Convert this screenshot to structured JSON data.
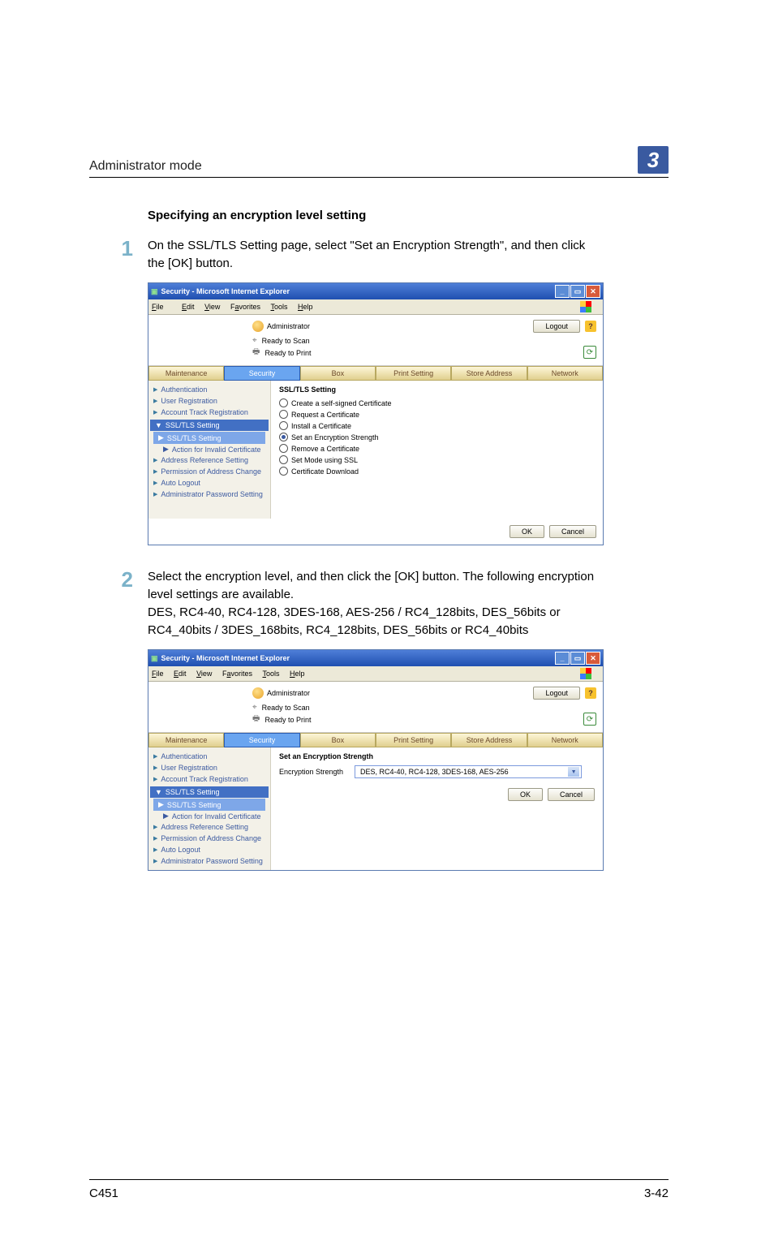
{
  "header": {
    "section_title": "Administrator mode",
    "section_number": "3"
  },
  "subhead": "Specifying an encryption level setting",
  "steps": {
    "s1": {
      "num": "1",
      "text": "On the SSL/TLS Setting page, select \"Set an Encryption Strength\", and then click the [OK] button."
    },
    "s2": {
      "num": "2",
      "text": "Select the encryption level, and then click the [OK] button. The following encryption level settings are available.\nDES, RC4-40, RC4-128, 3DES-168, AES-256 / RC4_128bits, DES_56bits or RC4_40bits / 3DES_168bits, RC4_128bits, DES_56bits or RC4_40bits"
    }
  },
  "browser_common": {
    "title": "Security - Microsoft Internet Explorer",
    "menus": {
      "file": "File",
      "edit": "Edit",
      "view": "View",
      "favorites": "Favorites",
      "tools": "Tools",
      "help": "Help"
    },
    "admin_label": "Administrator",
    "logout": "Logout",
    "status_scan": "Ready to Scan",
    "status_print": "Ready to Print",
    "tabs": {
      "maintenance": "Maintenance",
      "security": "Security",
      "box": "Box",
      "print": "Print Setting",
      "store": "Store Address",
      "network": "Network"
    },
    "ok": "OK",
    "cancel": "Cancel"
  },
  "sidebar": {
    "auth": "Authentication",
    "user_reg": "User Registration",
    "acct": "Account Track Registration",
    "ssl_cat": "SSL/TLS Setting",
    "ssl_sub": "SSL/TLS Setting",
    "action_invalid": "Action for Invalid Certificate",
    "addr_ref": "Address Reference Setting",
    "perm_change": "Permission of Address Change",
    "auto_logout": "Auto Logout",
    "admin_pwd": "Administrator Password Setting"
  },
  "panel1": {
    "title": "SSL/TLS Setting",
    "options": {
      "create": "Create a self-signed Certificate",
      "request": "Request a Certificate",
      "install": "Install a Certificate",
      "set_enc": "Set an Encryption Strength",
      "remove": "Remove a Certificate",
      "set_mode": "Set Mode using SSL",
      "download": "Certificate Download"
    }
  },
  "panel2": {
    "title": "Set an Encryption Strength",
    "label": "Encryption Strength",
    "select_value": "DES, RC4-40, RC4-128, 3DES-168, AES-256"
  },
  "footer": {
    "model": "C451",
    "page": "3-42"
  }
}
